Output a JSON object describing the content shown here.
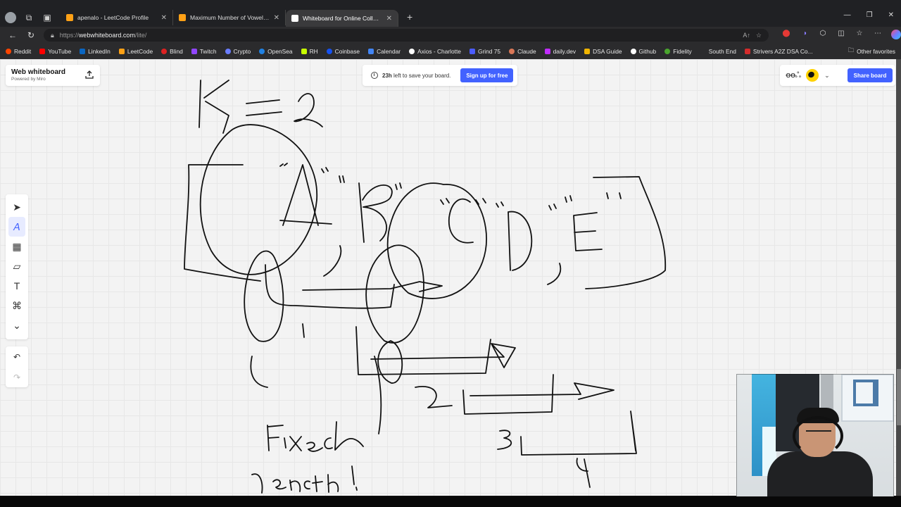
{
  "browser": {
    "tabs": [
      {
        "title": "apenalo - LeetCode Profile",
        "favicon_color": "#ffa116",
        "active": false
      },
      {
        "title": "Maximum Number of Vowels in a",
        "favicon_color": "#ffa116",
        "active": false
      },
      {
        "title": "Whiteboard for Online Collaborati",
        "favicon_color": "#ffffff",
        "active": true
      }
    ],
    "url": "https://webwhiteboard.com/lite/",
    "url_display": {
      "prefix": "https://",
      "host": "webwhiteboard.com",
      "path": "/lite/"
    }
  },
  "bookmarks": [
    {
      "label": "Reddit",
      "icon_color": "#ff4500"
    },
    {
      "label": "YouTube",
      "icon_color": "#ff0000"
    },
    {
      "label": "LinkedIn",
      "icon_color": "#0a66c2"
    },
    {
      "label": "LeetCode",
      "icon_color": "#ffa116"
    },
    {
      "label": "Blind",
      "icon_color": "#d22"
    },
    {
      "label": "Twitch",
      "icon_color": "#9146ff"
    },
    {
      "label": "Crypto",
      "icon_color": "#6a7dff"
    },
    {
      "label": "OpenSea",
      "icon_color": "#2081e2"
    },
    {
      "label": "RH",
      "icon_color": "#c8ff00"
    },
    {
      "label": "Coinbase",
      "icon_color": "#1652f0"
    },
    {
      "label": "Calendar",
      "icon_color": "#4285f4"
    },
    {
      "label": "Axios - Charlotte",
      "icon_color": "#ffffff"
    },
    {
      "label": "Grind 75",
      "icon_color": "#4b5cff"
    },
    {
      "label": "Claude",
      "icon_color": "#d97757"
    },
    {
      "label": "daily.dev",
      "icon_color": "#c02cff"
    },
    {
      "label": "DSA Guide",
      "icon_color": "#f0b400"
    },
    {
      "label": "Github",
      "icon_color": "#ffffff"
    },
    {
      "label": "Fidelity",
      "icon_color": "#4aa52e"
    },
    {
      "label": "South End",
      "icon_color": "#2b2b2d"
    },
    {
      "label": "Strivers A2Z DSA Co...",
      "icon_color": "#d42b2b"
    }
  ],
  "other_favorites": "Other favorites",
  "whiteboard": {
    "brand_title": "Web whiteboard",
    "brand_sub": "Powered by Miro",
    "save_hours": "23h",
    "save_text": " left to save your board.",
    "signup_label": "Sign up for free",
    "share_label": "Share board",
    "doodle_label": "ꝋꝋஃ"
  },
  "tools": [
    {
      "name": "select-tool",
      "icon": "➤"
    },
    {
      "name": "pen-tool",
      "icon": "𝘈"
    },
    {
      "name": "frame-tool",
      "icon": "▦"
    },
    {
      "name": "sticky-note-tool",
      "icon": "▱"
    },
    {
      "name": "text-tool",
      "icon": "T"
    },
    {
      "name": "shapes-tool",
      "icon": "⌘"
    },
    {
      "name": "more-tools",
      "icon": "⌄"
    }
  ],
  "undo_icons": {
    "undo": "↶",
    "redo": "↷"
  }
}
